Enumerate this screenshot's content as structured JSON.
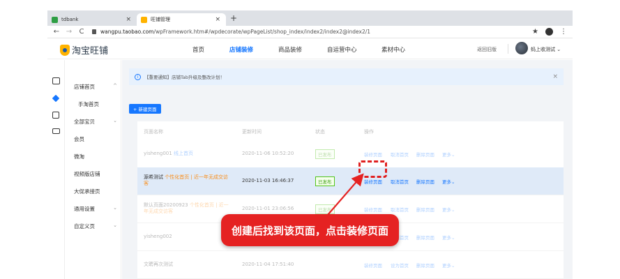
{
  "browser": {
    "tabs": [
      {
        "title": "tdbank",
        "close": "×"
      },
      {
        "title": "旺铺管理",
        "close": "×"
      }
    ],
    "new_tab": "+",
    "nav": {
      "back": "←",
      "forward": "→",
      "reload": "C"
    },
    "url_host": "wangpu.taobao.com",
    "url_path": "/wpFramework.htm#/wpdecorate/wpPageList/shop_index/index2/index2@index2/1",
    "star": "★",
    "menu": "⋮"
  },
  "header": {
    "logo": "淘宝旺铺",
    "nav": [
      "首页",
      "店铺装修",
      "商品装修",
      "自运营中心",
      "素材中心"
    ],
    "active_nav": "店铺装修",
    "old_version": "返回旧版",
    "username": "蚂上收测试",
    "user_caret": "⌄"
  },
  "sidebar": {
    "items": [
      {
        "label": "店铺首页",
        "arrow": "^"
      },
      {
        "label": "手淘首页",
        "arrow": ""
      },
      {
        "label": "全部宝贝",
        "arrow": "⌄"
      },
      {
        "label": "会员",
        "arrow": ""
      },
      {
        "label": "微淘",
        "arrow": ""
      },
      {
        "label": "视频版店铺",
        "arrow": ""
      },
      {
        "label": "大促承接页",
        "arrow": ""
      },
      {
        "label": "通用设置",
        "arrow": "⌄"
      },
      {
        "label": "自定义页",
        "arrow": "⌄"
      }
    ]
  },
  "notice": {
    "icon": "i",
    "text": "【重要通知】店铺Tab升级及整改计划！",
    "close": "×"
  },
  "new_page_button": "+ 新建页面",
  "table": {
    "headers": [
      "页面名称",
      "更新时间",
      "状态",
      "操作"
    ],
    "rows": [
      {
        "name": "yisheng001",
        "tag": "线上首页",
        "time": "2020-11-06 10:52:20",
        "status": "已发布",
        "actions": [
          "装修页面",
          "取消首页",
          "删除页面",
          "更多⌄"
        ]
      },
      {
        "name": "源希测试",
        "tag": "个性化首页 | 近一年无成交访客",
        "time": "2020-11-03 16:46:37",
        "status": "已发布",
        "actions": [
          "装修页面",
          "取消首页",
          "删除页面",
          "更多⌄"
        ]
      },
      {
        "name": "默认页面20200923",
        "tag": "个性化首页 | 近一年无成交访客",
        "time": "2020-11-01 23:06:56",
        "status": "已发布",
        "actions": [
          "装修页面",
          "取消首页",
          "删除页面",
          "更多⌄"
        ]
      },
      {
        "name": "yisheng002",
        "tag": "",
        "time": "",
        "status": "",
        "actions": [
          "",
          "取消首页",
          "删除页面",
          "更多⌄"
        ]
      },
      {
        "name": "文聘再次测试",
        "tag": "",
        "time": "2020-11-04 17:51:40",
        "status": "",
        "actions": [
          "装修页面",
          "设为首页",
          "删除页面",
          "更多⌄"
        ]
      }
    ]
  },
  "annotation": {
    "callout": "创建后找到该页面，点击装修页面",
    "color": "#e52222"
  }
}
